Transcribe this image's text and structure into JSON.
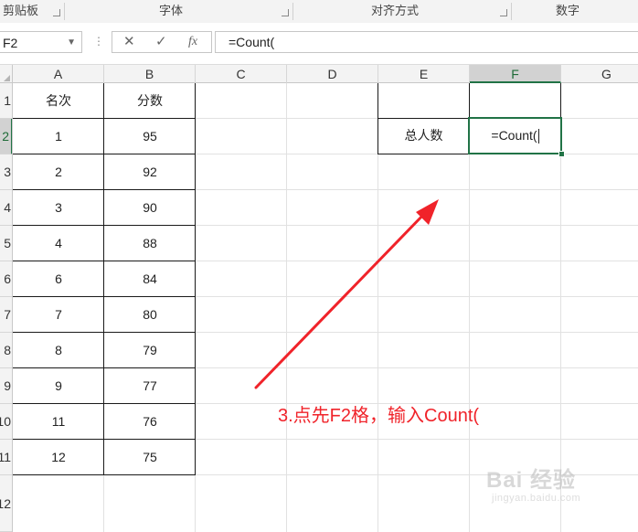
{
  "ribbon": {
    "groups": [
      "剪贴板",
      "字体",
      "对齐方式",
      "数字"
    ]
  },
  "formula_bar": {
    "name_box": "F2",
    "cancel_icon": "✕",
    "enter_icon": "✓",
    "fx_label": "fx",
    "formula": "=Count("
  },
  "sheet": {
    "columns": [
      "A",
      "B",
      "C",
      "D",
      "E",
      "F",
      "G"
    ],
    "selected_column": "F",
    "rows": [
      "1",
      "2",
      "3",
      "4",
      "5",
      "6",
      "7",
      "8",
      "9",
      "10",
      "11",
      "12"
    ],
    "selected_row": "2",
    "table": {
      "header": [
        "名次",
        "分数"
      ],
      "rows": [
        [
          "1",
          "95"
        ],
        [
          "2",
          "92"
        ],
        [
          "3",
          "90"
        ],
        [
          "4",
          "88"
        ],
        [
          "6",
          "84"
        ],
        [
          "7",
          "80"
        ],
        [
          "8",
          "79"
        ],
        [
          "9",
          "77"
        ],
        [
          "11",
          "76"
        ],
        [
          "12",
          "75"
        ]
      ]
    },
    "e2_label": "总人数",
    "f2_value": "=Count("
  },
  "annotation": {
    "text": "3.点先F2格，输入Count(",
    "color": "#f0232a"
  },
  "watermark": {
    "logo": "Bai 经验",
    "url": "jingyan.baidu.com"
  },
  "colors": {
    "accent": "#217346",
    "header_bg": "#f3f3f3"
  }
}
